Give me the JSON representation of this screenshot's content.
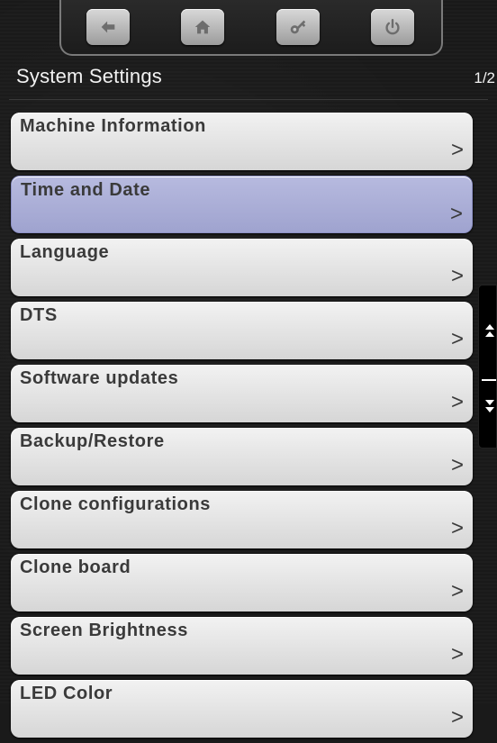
{
  "toolbar": {
    "buttons": [
      {
        "icon": "back-arrow-icon"
      },
      {
        "icon": "home-icon"
      },
      {
        "icon": "key-icon"
      },
      {
        "icon": "power-icon"
      }
    ]
  },
  "header": {
    "title": "System Settings",
    "page_indicator": "1/2"
  },
  "menu": {
    "selected_index": 1,
    "arrow": ">",
    "items": [
      {
        "label": "Machine Information"
      },
      {
        "label": "Time and Date"
      },
      {
        "label": "Language"
      },
      {
        "label": "DTS"
      },
      {
        "label": "Software updates"
      },
      {
        "label": "Backup/Restore"
      },
      {
        "label": "Clone configurations"
      },
      {
        "label": "Clone board"
      },
      {
        "label": "Screen Brightness"
      },
      {
        "label": "LED Color"
      }
    ]
  },
  "colors": {
    "selected_item": "#a9acd6",
    "item": "#e3e3e3",
    "background": "#1a1a1a",
    "text": "#3a3a3a"
  }
}
